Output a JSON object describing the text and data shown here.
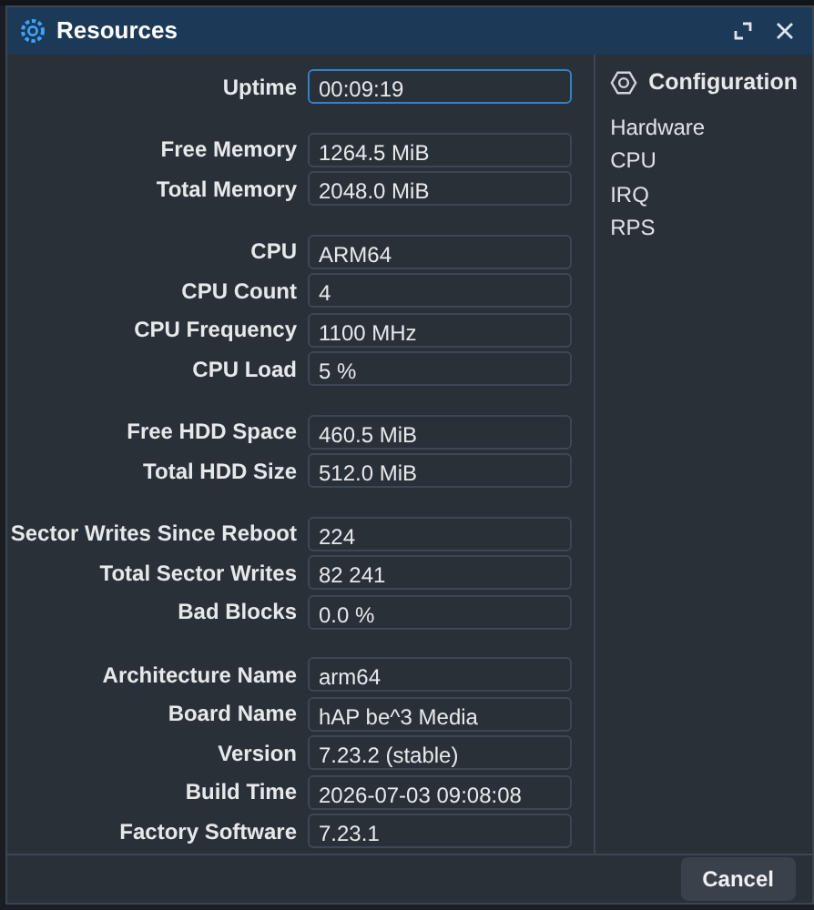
{
  "window": {
    "title": "Resources"
  },
  "groups": [
    [
      {
        "label": "Uptime",
        "value": "00:09:19",
        "focused": true
      }
    ],
    [
      {
        "label": "Free Memory",
        "value": "1264.5 MiB",
        "focused": false
      },
      {
        "label": "Total Memory",
        "value": "2048.0 MiB",
        "focused": false
      }
    ],
    [
      {
        "label": "CPU",
        "value": "ARM64",
        "focused": false
      },
      {
        "label": "CPU Count",
        "value": "4",
        "focused": false
      },
      {
        "label": "CPU Frequency",
        "value": "1100 MHz",
        "focused": false
      },
      {
        "label": "CPU Load",
        "value": "5 %",
        "focused": false
      }
    ],
    [
      {
        "label": "Free HDD Space",
        "value": "460.5 MiB",
        "focused": false
      },
      {
        "label": "Total HDD Size",
        "value": "512.0 MiB",
        "focused": false
      }
    ],
    [
      {
        "label": "Sector Writes Since Reboot",
        "value": "224",
        "focused": false
      },
      {
        "label": "Total Sector Writes",
        "value": "82 241",
        "focused": false
      },
      {
        "label": "Bad Blocks",
        "value": "0.0 %",
        "focused": false
      }
    ],
    [
      {
        "label": "Architecture Name",
        "value": "arm64",
        "focused": false
      },
      {
        "label": "Board Name",
        "value": "hAP be^3 Media",
        "focused": false
      },
      {
        "label": "Version",
        "value": "7.23.2 (stable)",
        "focused": false
      },
      {
        "label": "Build Time",
        "value": "2026-07-03 09:08:08",
        "focused": false
      },
      {
        "label": "Factory Software",
        "value": "7.23.1",
        "focused": false
      }
    ]
  ],
  "sidebar": {
    "title": "Configuration",
    "items": [
      "Hardware",
      "CPU",
      "IRQ",
      "RPS"
    ]
  },
  "buttons": [
    "Cancel"
  ]
}
